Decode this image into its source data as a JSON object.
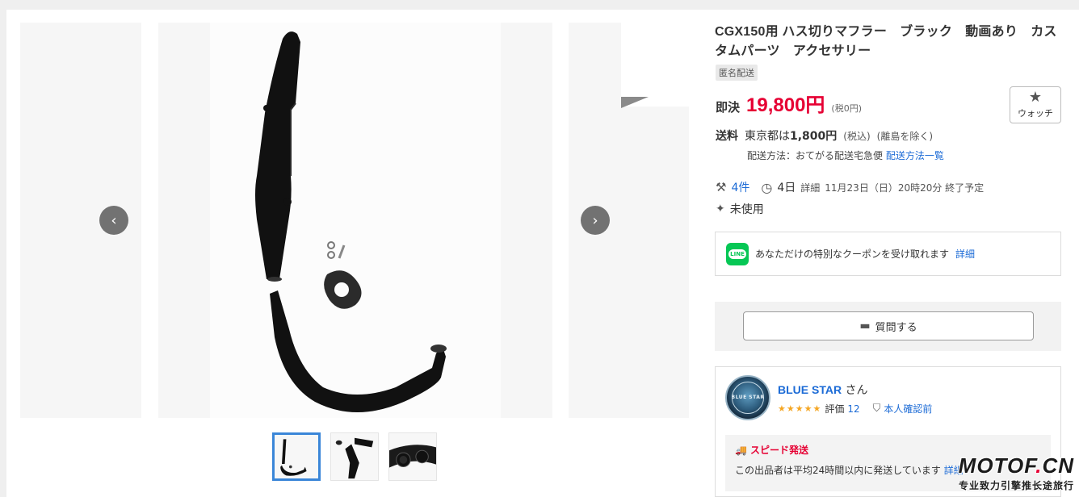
{
  "gallery": {
    "prev_icon": "chevron-left-icon",
    "next_icon": "chevron-right-icon",
    "prev_label": "‹",
    "next_label": "›",
    "thumbnails": [
      {
        "name": "thumbnail-1",
        "active": true
      },
      {
        "name": "thumbnail-2",
        "active": false
      },
      {
        "name": "thumbnail-3",
        "active": false
      }
    ]
  },
  "product": {
    "title": "CGX150用 ハス切りマフラー　ブラック　動画あり　カスタムパーツ　アクセサリー",
    "tag": "匿名配送",
    "price_label": "即決",
    "price": "19,800円",
    "tax_note": "(税0円)",
    "watch_label": "ウォッチ",
    "watch_icon": "star-icon"
  },
  "shipping": {
    "label": "送料",
    "fee_prefix": "東京都は",
    "fee": "1,800円",
    "fee_tax": "(税込)",
    "exclusion": "(離島を除く)",
    "method": "配送方法：おてがる配送宅急便",
    "method_link": "配送方法一覧"
  },
  "meta": {
    "bids": "4件",
    "remaining": "4日",
    "detail_link": "詳細",
    "end_time": "11月23日（日）20時20分 終了予定",
    "condition": "未使用"
  },
  "coupon": {
    "icon_text": "LINE",
    "text": "あなただけの特別なクーポンを受け取れます",
    "link": "詳細"
  },
  "ask": {
    "label": "質問する"
  },
  "seller": {
    "avatar_text": "BLUE STAR",
    "name": "BLUE STAR",
    "suffix": "さん",
    "stars": "★★★★★",
    "rating_label": "評価",
    "rating_count": "12",
    "verify": "本人確認前",
    "speed_title": "スピード発送",
    "speed_desc": "この出品者は平均24時間以内に発送しています",
    "speed_link": "詳細"
  },
  "watermark": {
    "main_a": "MOTOF",
    "main_dot": ".",
    "main_b": "CN",
    "sub": "专业致力引擎推长途旅行"
  },
  "colors": {
    "price": "#e60033",
    "link": "#1c6bd6",
    "line": "#06c755",
    "active_thumb": "#3a86d8"
  }
}
